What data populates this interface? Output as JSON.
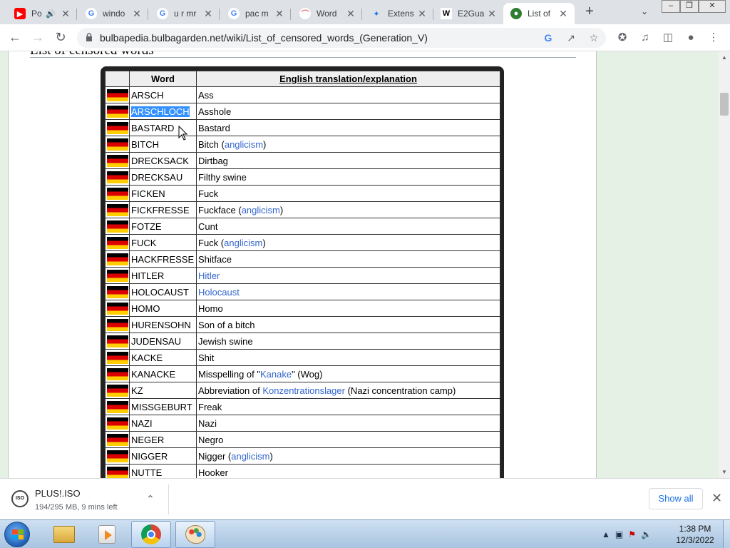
{
  "tabs": [
    {
      "title": "Po",
      "icon": "youtube-icon",
      "audio": true
    },
    {
      "title": "windo",
      "icon": "google-icon"
    },
    {
      "title": "u r mr",
      "icon": "google-icon"
    },
    {
      "title": "pac m",
      "icon": "google-icon"
    },
    {
      "title": "Word",
      "icon": "rainbow-icon"
    },
    {
      "title": "Extens",
      "icon": "puzzle-icon"
    },
    {
      "title": "E2Gua",
      "icon": "wikipedia-icon"
    },
    {
      "title": "List of",
      "icon": "bulbapedia-icon",
      "active": true
    }
  ],
  "toolbar": {
    "url": "bulbapedia.bulbagarden.net/wiki/List_of_censored_words_(Generation_V)"
  },
  "page": {
    "heading": "List of censored words"
  },
  "table": {
    "headers": [
      "Word",
      "English translation/explanation"
    ],
    "rows": [
      {
        "word": "ARSCH",
        "translation": [
          {
            "text": "Ass"
          }
        ]
      },
      {
        "word": "ARSCHLOCH",
        "selected": true,
        "translation": [
          {
            "text": "Asshole"
          }
        ]
      },
      {
        "word": "BASTARD",
        "translation": [
          {
            "text": "Bastard"
          }
        ]
      },
      {
        "word": "BITCH",
        "translation": [
          {
            "text": "Bitch ("
          },
          {
            "text": "anglicism",
            "link": true
          },
          {
            "text": ")"
          }
        ]
      },
      {
        "word": "DRECKSACK",
        "translation": [
          {
            "text": "Dirtbag"
          }
        ]
      },
      {
        "word": "DRECKSAU",
        "translation": [
          {
            "text": "Filthy swine"
          }
        ]
      },
      {
        "word": "FICKEN",
        "translation": [
          {
            "text": "Fuck"
          }
        ]
      },
      {
        "word": "FICKFRESSE",
        "translation": [
          {
            "text": "Fuckface ("
          },
          {
            "text": "anglicism",
            "link": true
          },
          {
            "text": ")"
          }
        ]
      },
      {
        "word": "FOTZE",
        "translation": [
          {
            "text": "Cunt"
          }
        ]
      },
      {
        "word": "FUCK",
        "translation": [
          {
            "text": "Fuck ("
          },
          {
            "text": "anglicism",
            "link": true
          },
          {
            "text": ")"
          }
        ]
      },
      {
        "word": "HACKFRESSE",
        "translation": [
          {
            "text": "Shitface"
          }
        ]
      },
      {
        "word": "HITLER",
        "translation": [
          {
            "text": "Hitler",
            "link": true
          }
        ]
      },
      {
        "word": "HOLOCAUST",
        "translation": [
          {
            "text": "Holocaust",
            "link": true
          }
        ]
      },
      {
        "word": "HOMO",
        "translation": [
          {
            "text": "Homo"
          }
        ]
      },
      {
        "word": "HURENSOHN",
        "translation": [
          {
            "text": "Son of a bitch"
          }
        ]
      },
      {
        "word": "JUDENSAU",
        "translation": [
          {
            "text": "Jewish swine"
          }
        ]
      },
      {
        "word": "KACKE",
        "translation": [
          {
            "text": "Shit"
          }
        ]
      },
      {
        "word": "KANACKE",
        "translation": [
          {
            "text": "Misspelling of \""
          },
          {
            "text": "Kanake",
            "link": true
          },
          {
            "text": "\" (Wog)"
          }
        ]
      },
      {
        "word": "KZ",
        "translation": [
          {
            "text": "Abbreviation of "
          },
          {
            "text": "Konzentrationslager",
            "link": true
          },
          {
            "text": " (Nazi concentration camp)"
          }
        ]
      },
      {
        "word": "MISSGEBURT",
        "translation": [
          {
            "text": "Freak"
          }
        ]
      },
      {
        "word": "NAZI",
        "translation": [
          {
            "text": "Nazi"
          }
        ]
      },
      {
        "word": "NEGER",
        "translation": [
          {
            "text": "Negro"
          }
        ]
      },
      {
        "word": "NIGGER",
        "translation": [
          {
            "text": "Nigger ("
          },
          {
            "text": "anglicism",
            "link": true
          },
          {
            "text": ")"
          }
        ]
      },
      {
        "word": "NUTTE",
        "translation": [
          {
            "text": "Hooker"
          }
        ]
      }
    ]
  },
  "download": {
    "filename": "PLUS!.ISO",
    "status": "194/295 MB, 9 mins left",
    "icon_text": "ISO",
    "show_all": "Show all"
  },
  "taskbar": {
    "time": "1:38 PM",
    "date": "12/3/2022"
  },
  "colors": {
    "link": "#3366cc",
    "selection": "#3390ff",
    "page_bg": "#e4f1e4",
    "tab_strip": "#dee1e6"
  }
}
